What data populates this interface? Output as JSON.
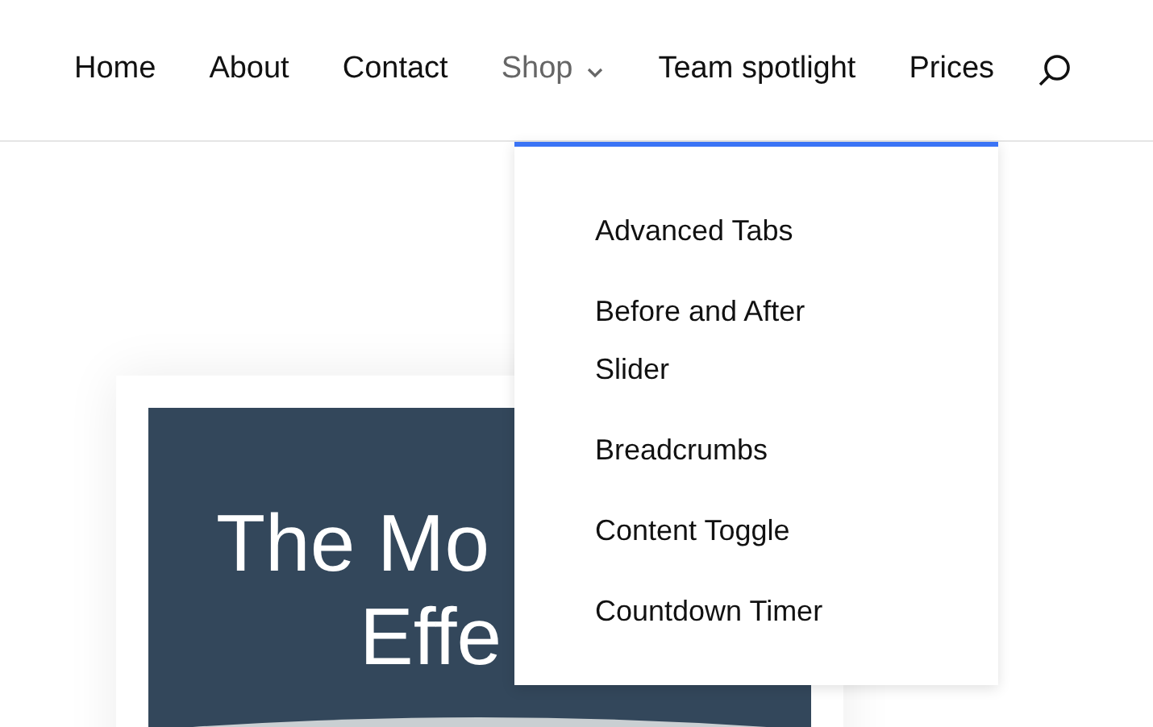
{
  "nav": {
    "items": [
      {
        "label": "Home",
        "kind": "link",
        "selected": false
      },
      {
        "label": "About",
        "kind": "link",
        "selected": false
      },
      {
        "label": "Contact",
        "kind": "link",
        "selected": false
      },
      {
        "label": "Shop",
        "kind": "dropdown",
        "selected": true
      },
      {
        "label": "Team spotlight",
        "kind": "link",
        "selected": false
      },
      {
        "label": "Prices",
        "kind": "link",
        "selected": false
      }
    ]
  },
  "dropdown_menu": {
    "items": [
      "Advanced Tabs",
      "Before and After Slider",
      "Breadcrumbs",
      "Content Toggle",
      "Countdown Timer"
    ]
  },
  "banner": {
    "lines": [
      "The Mo",
      "Effe"
    ]
  }
}
